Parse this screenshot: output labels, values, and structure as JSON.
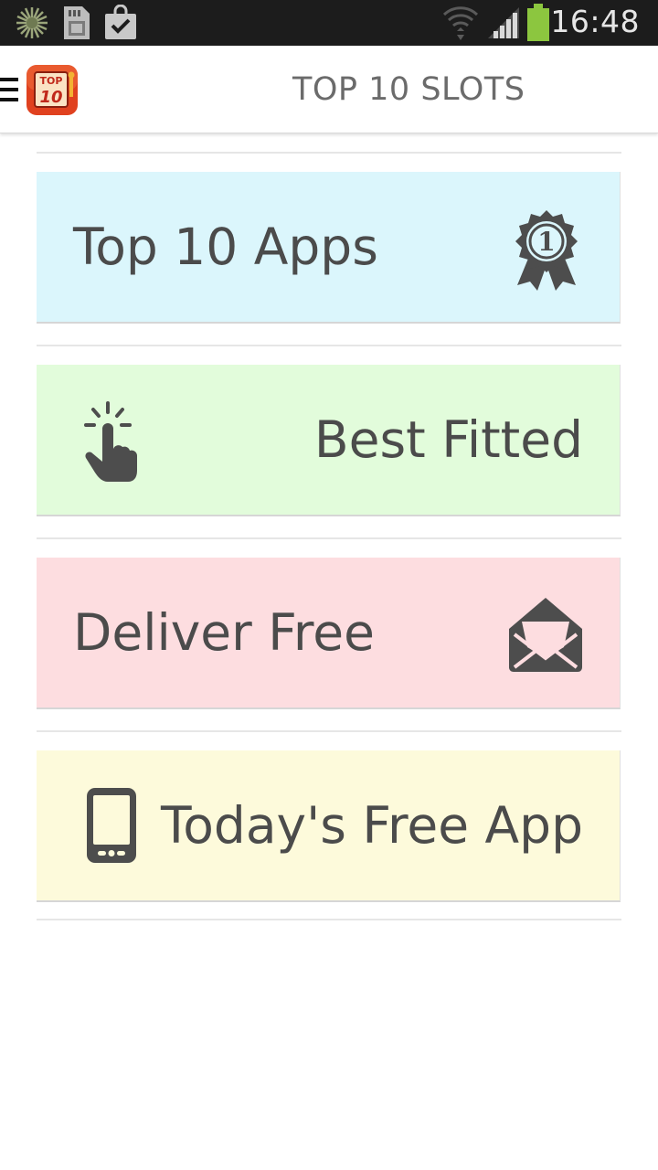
{
  "status_bar": {
    "time": "16:48",
    "icons": [
      "sun-burst-icon",
      "sd-card-icon",
      "shopping-bag-icon",
      "wifi-icon",
      "signal-icon",
      "battery-icon"
    ],
    "battery_color": "#8cc63f"
  },
  "header": {
    "title": "TOP 10 SLOTS",
    "logo_text_top": "TOP",
    "logo_text_bottom": "10"
  },
  "cards": [
    {
      "label": "Top 10 Apps",
      "bg": "#dbf6fc",
      "icon": "award-ribbon-icon",
      "icon_text": "1"
    },
    {
      "label": "Best Fitted",
      "bg": "#e2fcdb",
      "icon": "hand-tap-icon"
    },
    {
      "label": "Deliver Free",
      "bg": "#fddde0",
      "icon": "open-envelope-icon"
    },
    {
      "label": "Today's Free App",
      "bg": "#fdfadb",
      "icon": "mobile-phone-icon"
    }
  ]
}
